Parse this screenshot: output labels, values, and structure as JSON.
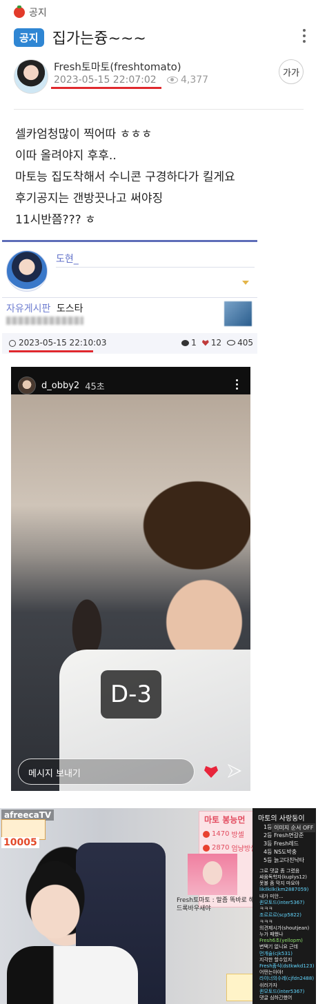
{
  "category": {
    "label": "공지",
    "icon": "tomato-icon"
  },
  "post": {
    "badge": "공지",
    "title": "집가는즁~~~",
    "author": "Fresh토마토(freshtomato)",
    "date": "2023-05-15 22:07:02",
    "views": "4,377",
    "font_button": "가가",
    "body": [
      "셀카엄청많이 찍어따 ㅎㅎㅎ",
      "이따 올려야지 후후..",
      "마토능 집도착해서 수니콘 구경하다가 킬게요",
      "후기공지는 갠방끗나고 써야징",
      "11시반쯤??? ㅎ"
    ]
  },
  "embed": {
    "nickname": "도현_",
    "board": "자유게시판",
    "board_title": "도스타",
    "date": "2023-05-15 22:10:03",
    "comments": "1",
    "likes": "12",
    "views": "405"
  },
  "story": {
    "username": "d_obby2",
    "time": "45초",
    "badge": "D-3",
    "message_placeholder": "메시지 보내기"
  },
  "stream": {
    "logo": "afreecaTV",
    "overlay_number": "10005",
    "pink_title": "마토 봉능먼",
    "pink_rows": [
      {
        "value": "1470",
        "label": "방셀"
      },
      {
        "value": "2870",
        "label": "엄냥방셀"
      }
    ],
    "overlay_caption": "Fresh토마토 : 말좀 똑바로 해 드록바우새야",
    "chat": {
      "title": "마토의 사랑둥이",
      "option": "이미지 순서 OFF",
      "ranks": [
        "1등",
        "2등 Fresh면갈준",
        "3등 Fresh레드",
        "4등 NS도박충",
        "5등 늙고다친낙타"
      ],
      "lines": [
        {
          "text": "그로 댓글 좀 그렸음",
          "style": "white"
        },
        {
          "text": "싸움독학자(kuplys12)",
          "style": "white"
        },
        {
          "text": "못볼 좀 막지 마요야",
          "style": "white"
        },
        {
          "text": "likilkilk(km2887059)",
          "style": "cyan"
        },
        {
          "text": "내가 미안...",
          "style": "white"
        },
        {
          "text": "퀸모토드(inter5367)",
          "style": "cyan"
        },
        {
          "text": "ㅋㅋㅋ",
          "style": "white"
        },
        {
          "text": "조르르르(scp5822)",
          "style": "cyan"
        },
        {
          "text": "ㅋㅋㅋ",
          "style": "white"
        },
        {
          "text": "의견제시가(shoutjean)",
          "style": "white"
        },
        {
          "text": "누가 패했나",
          "style": "white"
        },
        {
          "text": "Fresh6초(yellopm)",
          "style": "green"
        },
        {
          "text": "변택기 없니요 근데",
          "style": "white"
        },
        {
          "text": "먼개술(cjk531)",
          "style": "cyan"
        },
        {
          "text": "지각한 할수있지",
          "style": "white"
        },
        {
          "text": "Fresh좀식(dstkwkd123)",
          "style": "cyan"
        },
        {
          "text": "어떤는아야!",
          "style": "white"
        },
        {
          "text": "라이너의수레(cjfdn2488)",
          "style": "cyan"
        },
        {
          "text": "쉬러가자",
          "style": "white"
        },
        {
          "text": "퀸모토드(inter5367)",
          "style": "cyan"
        },
        {
          "text": "댓글 심하긴했어",
          "style": "white"
        }
      ]
    }
  }
}
